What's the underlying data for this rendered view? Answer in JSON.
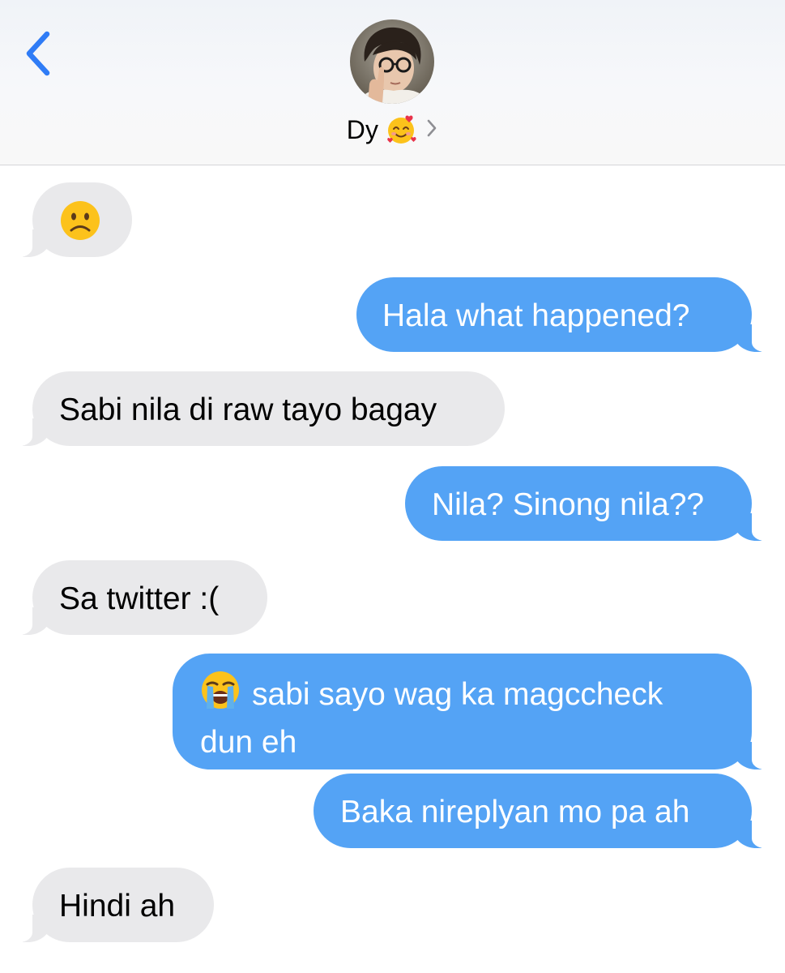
{
  "header": {
    "back_icon": "chevron-left-icon",
    "contact_name": "Dy",
    "contact_emoji": "smiling-face-with-hearts-emoji",
    "chevron_icon": "chevron-right-icon",
    "accent_color": "#2f7cf6"
  },
  "colors": {
    "sent_bubble": "#54a3f5",
    "received_bubble": "#e9e9eb"
  },
  "messages": [
    {
      "direction": "received",
      "text": "",
      "emoji": "frowning-face-emoji"
    },
    {
      "direction": "sent",
      "text": "Hala what happened?"
    },
    {
      "direction": "received",
      "text": "Sabi nila di raw tayo bagay"
    },
    {
      "direction": "sent",
      "text": "Nila? Sinong nila??"
    },
    {
      "direction": "received",
      "text": "Sa twitter :("
    },
    {
      "direction": "sent",
      "text_line1": "sabi sayo wag ka magccheck",
      "text_line2": "dun eh",
      "emoji": "loudly-crying-face-emoji"
    },
    {
      "direction": "sent",
      "text": "Baka nireplyan mo pa ah"
    },
    {
      "direction": "received",
      "text": "Hindi ah"
    }
  ]
}
